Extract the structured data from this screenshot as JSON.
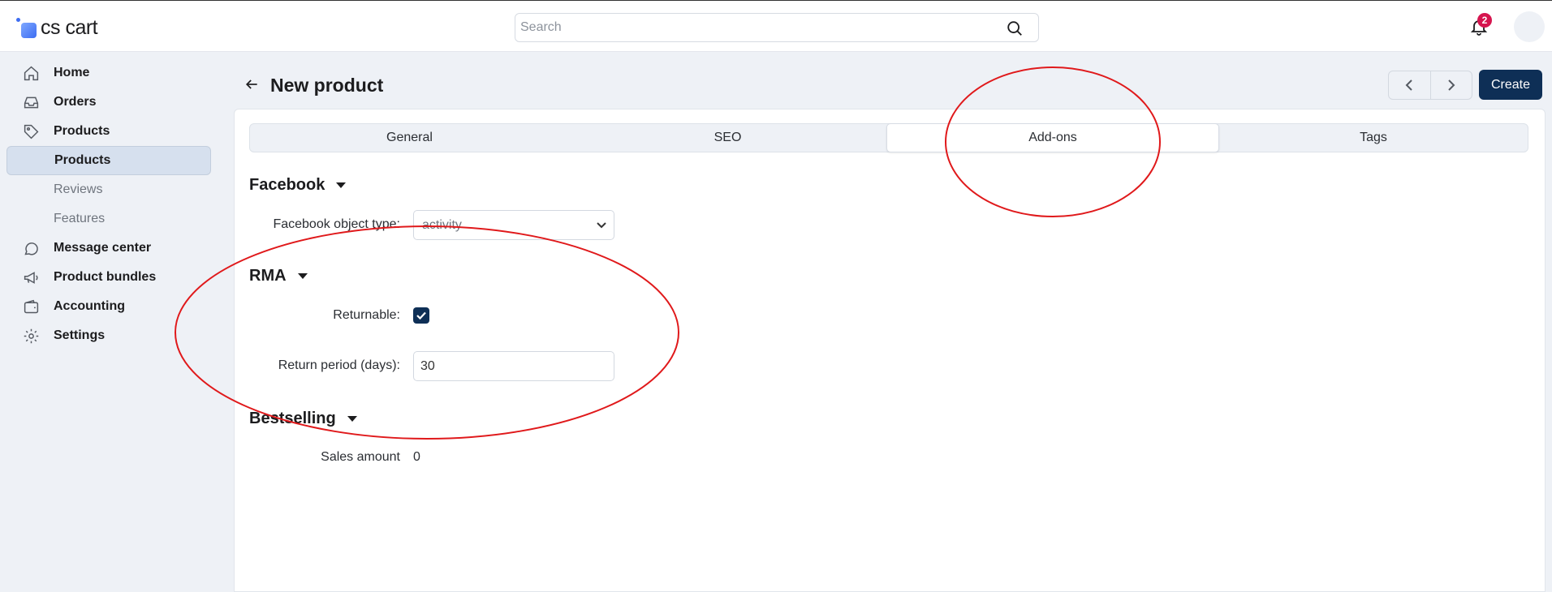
{
  "brand": {
    "logo_text": "cs cart"
  },
  "search": {
    "placeholder": "Search"
  },
  "notifications": {
    "count": "2"
  },
  "sidebar": {
    "items": [
      {
        "label": "Home",
        "icon": "home-icon"
      },
      {
        "label": "Orders",
        "icon": "inbox-icon"
      },
      {
        "label": "Products",
        "icon": "tag-icon"
      },
      {
        "label": "Products",
        "sub": true,
        "active": true
      },
      {
        "label": "Reviews",
        "sub": true
      },
      {
        "label": "Features",
        "sub": true
      },
      {
        "label": "Message center",
        "icon": "chat-icon"
      },
      {
        "label": "Product bundles",
        "icon": "megaphone-icon"
      },
      {
        "label": "Accounting",
        "icon": "wallet-icon"
      },
      {
        "label": "Settings",
        "icon": "gear-icon"
      }
    ]
  },
  "header": {
    "title": "New product",
    "create_label": "Create"
  },
  "tabs": [
    {
      "label": "General"
    },
    {
      "label": "SEO"
    },
    {
      "label": "Add-ons",
      "active": true
    },
    {
      "label": "Tags"
    }
  ],
  "sections": {
    "facebook": {
      "title": "Facebook",
      "object_type_label": "Facebook object type:",
      "object_type_value": "activity"
    },
    "rma": {
      "title": "RMA",
      "returnable_label": "Returnable:",
      "returnable_checked": true,
      "return_period_label": "Return period (days):",
      "return_period_value": "30"
    },
    "bestselling": {
      "title": "Bestselling",
      "sales_amount_label": "Sales amount",
      "sales_amount_value": "0"
    }
  },
  "colors": {
    "accent": "#0e2f56",
    "badge": "#d6154f",
    "annotation": "#e0191b"
  }
}
